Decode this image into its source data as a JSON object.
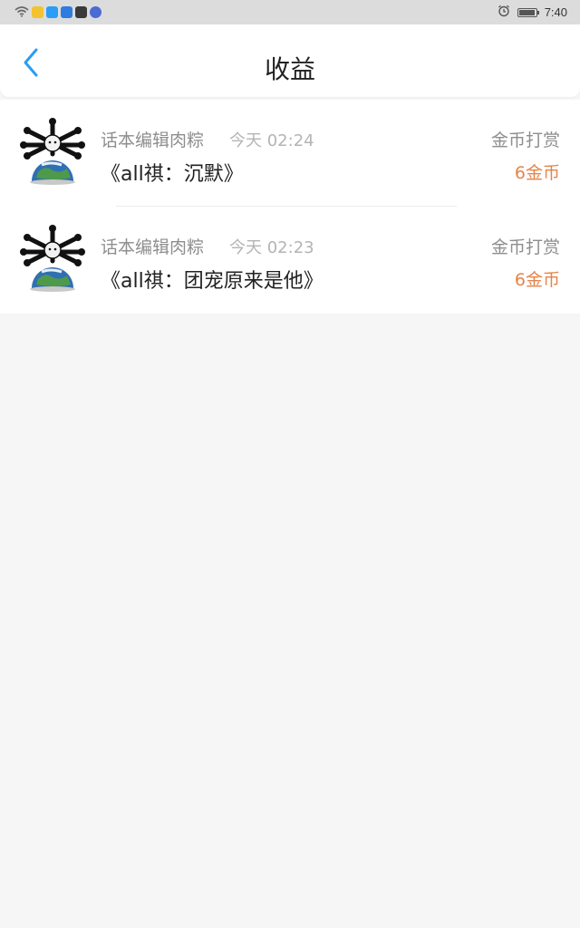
{
  "status_bar": {
    "time": "7:40",
    "notification_icons": [
      {
        "name": "wifi-icon",
        "color": "#666666"
      },
      {
        "name": "app-icon-1",
        "color": "#f2c230"
      },
      {
        "name": "app-icon-2",
        "color": "#2a9df4"
      },
      {
        "name": "app-icon-3",
        "color": "#2f7be0"
      },
      {
        "name": "app-icon-4",
        "color": "#3a3a3a"
      },
      {
        "name": "app-icon-5",
        "color": "#4a6cd4"
      }
    ],
    "right_icons": [
      "alarm-icon",
      "battery-icon"
    ],
    "battery_level": 0.95
  },
  "header": {
    "title": "收益",
    "back_icon": "chevron-left-icon",
    "back_color": "#2a9df4"
  },
  "items": [
    {
      "author": "话本编辑肉粽",
      "time": "今天 02:24",
      "type": "金币打赏",
      "book_title": "《all祺：沉默》",
      "amount": "6金币"
    },
    {
      "author": "话本编辑肉粽",
      "time": "今天 02:23",
      "type": "金币打赏",
      "book_title": "《all祺：团宠原来是他》",
      "amount": "6金币"
    }
  ],
  "colors": {
    "amount": "#e5844a",
    "background": "#f7f6f6"
  }
}
